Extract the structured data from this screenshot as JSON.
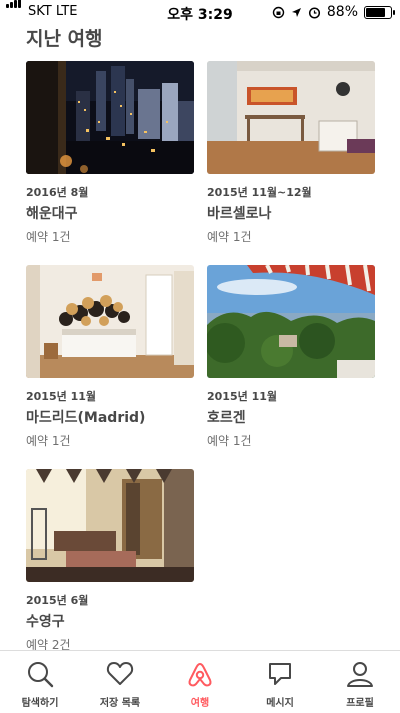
{
  "status_bar": {
    "carrier": "SKT  LTE",
    "time": "오후 3:29",
    "battery": "88%"
  },
  "page_title": "지난 여행",
  "trips": [
    {
      "date": "2016년 8월",
      "name": "해운대구",
      "bookings": "예약 1건"
    },
    {
      "date": "2015년 11월~12월",
      "name": "바르셀로나",
      "bookings": "예약 1건"
    },
    {
      "date": "2015년 11월",
      "name": "마드리드(Madrid)",
      "bookings": "예약 1건"
    },
    {
      "date": "2015년 11월",
      "name": "호르겐",
      "bookings": "예약 1건"
    },
    {
      "date": "2015년 6월",
      "name": "수영구",
      "bookings": "예약 2건"
    }
  ],
  "tabs": [
    {
      "label": "탐색하기",
      "icon": "search-icon"
    },
    {
      "label": "저장 목록",
      "icon": "heart-icon"
    },
    {
      "label": "여행",
      "icon": "airbnb-logo-icon",
      "active": true
    },
    {
      "label": "메시지",
      "icon": "message-icon"
    },
    {
      "label": "프로필",
      "icon": "profile-icon"
    }
  ],
  "colors": {
    "accent": "#FF5A5F",
    "text": "#484848"
  }
}
